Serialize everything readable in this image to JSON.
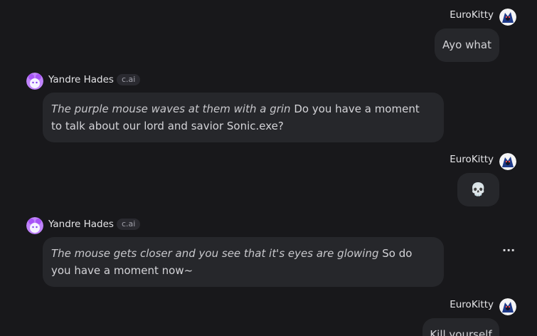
{
  "messages": [
    {
      "role": "user",
      "name": "EuroKitty",
      "text": "Ayo what"
    },
    {
      "role": "bot",
      "name": "Yandre Hades",
      "badge": "c.ai",
      "action": "The purple mouse waves at them with a grin",
      "text": " Do you have a moment to talk about our lord and savior Sonic.exe?"
    },
    {
      "role": "user",
      "name": "EuroKitty",
      "text": "💀"
    },
    {
      "role": "bot",
      "name": "Yandre Hades",
      "badge": "c.ai",
      "action": "The mouse gets closer and you see that it's eyes are glowing",
      "text": " So do you have a moment now~"
    },
    {
      "role": "user",
      "name": "EuroKitty",
      "text": "Kill yourself"
    }
  ],
  "more_menu": "···",
  "colors": {
    "background": "#18181b",
    "bubble": "#26272b",
    "bot_avatar": "#a855f7",
    "user_avatar": "#1e3a8a"
  }
}
